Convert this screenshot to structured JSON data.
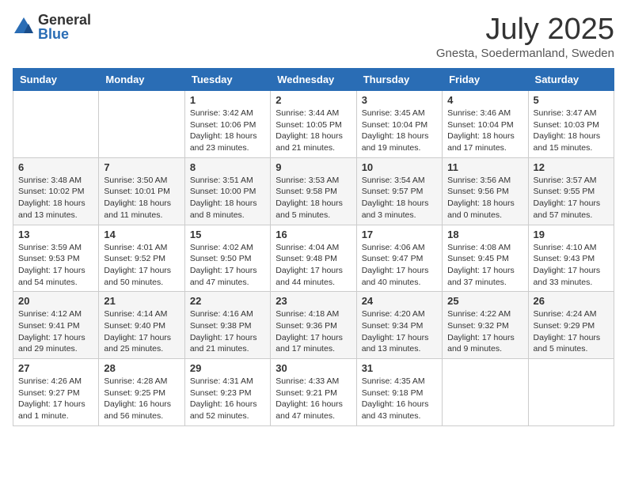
{
  "header": {
    "logo_general": "General",
    "logo_blue": "Blue",
    "month_title": "July 2025",
    "subtitle": "Gnesta, Soedermanland, Sweden"
  },
  "weekdays": [
    "Sunday",
    "Monday",
    "Tuesday",
    "Wednesday",
    "Thursday",
    "Friday",
    "Saturday"
  ],
  "weeks": [
    [
      {
        "day": "",
        "info": ""
      },
      {
        "day": "",
        "info": ""
      },
      {
        "day": "1",
        "info": "Sunrise: 3:42 AM\nSunset: 10:06 PM\nDaylight: 18 hours\nand 23 minutes."
      },
      {
        "day": "2",
        "info": "Sunrise: 3:44 AM\nSunset: 10:05 PM\nDaylight: 18 hours\nand 21 minutes."
      },
      {
        "day": "3",
        "info": "Sunrise: 3:45 AM\nSunset: 10:04 PM\nDaylight: 18 hours\nand 19 minutes."
      },
      {
        "day": "4",
        "info": "Sunrise: 3:46 AM\nSunset: 10:04 PM\nDaylight: 18 hours\nand 17 minutes."
      },
      {
        "day": "5",
        "info": "Sunrise: 3:47 AM\nSunset: 10:03 PM\nDaylight: 18 hours\nand 15 minutes."
      }
    ],
    [
      {
        "day": "6",
        "info": "Sunrise: 3:48 AM\nSunset: 10:02 PM\nDaylight: 18 hours\nand 13 minutes."
      },
      {
        "day": "7",
        "info": "Sunrise: 3:50 AM\nSunset: 10:01 PM\nDaylight: 18 hours\nand 11 minutes."
      },
      {
        "day": "8",
        "info": "Sunrise: 3:51 AM\nSunset: 10:00 PM\nDaylight: 18 hours\nand 8 minutes."
      },
      {
        "day": "9",
        "info": "Sunrise: 3:53 AM\nSunset: 9:58 PM\nDaylight: 18 hours\nand 5 minutes."
      },
      {
        "day": "10",
        "info": "Sunrise: 3:54 AM\nSunset: 9:57 PM\nDaylight: 18 hours\nand 3 minutes."
      },
      {
        "day": "11",
        "info": "Sunrise: 3:56 AM\nSunset: 9:56 PM\nDaylight: 18 hours\nand 0 minutes."
      },
      {
        "day": "12",
        "info": "Sunrise: 3:57 AM\nSunset: 9:55 PM\nDaylight: 17 hours\nand 57 minutes."
      }
    ],
    [
      {
        "day": "13",
        "info": "Sunrise: 3:59 AM\nSunset: 9:53 PM\nDaylight: 17 hours\nand 54 minutes."
      },
      {
        "day": "14",
        "info": "Sunrise: 4:01 AM\nSunset: 9:52 PM\nDaylight: 17 hours\nand 50 minutes."
      },
      {
        "day": "15",
        "info": "Sunrise: 4:02 AM\nSunset: 9:50 PM\nDaylight: 17 hours\nand 47 minutes."
      },
      {
        "day": "16",
        "info": "Sunrise: 4:04 AM\nSunset: 9:48 PM\nDaylight: 17 hours\nand 44 minutes."
      },
      {
        "day": "17",
        "info": "Sunrise: 4:06 AM\nSunset: 9:47 PM\nDaylight: 17 hours\nand 40 minutes."
      },
      {
        "day": "18",
        "info": "Sunrise: 4:08 AM\nSunset: 9:45 PM\nDaylight: 17 hours\nand 37 minutes."
      },
      {
        "day": "19",
        "info": "Sunrise: 4:10 AM\nSunset: 9:43 PM\nDaylight: 17 hours\nand 33 minutes."
      }
    ],
    [
      {
        "day": "20",
        "info": "Sunrise: 4:12 AM\nSunset: 9:41 PM\nDaylight: 17 hours\nand 29 minutes."
      },
      {
        "day": "21",
        "info": "Sunrise: 4:14 AM\nSunset: 9:40 PM\nDaylight: 17 hours\nand 25 minutes."
      },
      {
        "day": "22",
        "info": "Sunrise: 4:16 AM\nSunset: 9:38 PM\nDaylight: 17 hours\nand 21 minutes."
      },
      {
        "day": "23",
        "info": "Sunrise: 4:18 AM\nSunset: 9:36 PM\nDaylight: 17 hours\nand 17 minutes."
      },
      {
        "day": "24",
        "info": "Sunrise: 4:20 AM\nSunset: 9:34 PM\nDaylight: 17 hours\nand 13 minutes."
      },
      {
        "day": "25",
        "info": "Sunrise: 4:22 AM\nSunset: 9:32 PM\nDaylight: 17 hours\nand 9 minutes."
      },
      {
        "day": "26",
        "info": "Sunrise: 4:24 AM\nSunset: 9:29 PM\nDaylight: 17 hours\nand 5 minutes."
      }
    ],
    [
      {
        "day": "27",
        "info": "Sunrise: 4:26 AM\nSunset: 9:27 PM\nDaylight: 17 hours\nand 1 minute."
      },
      {
        "day": "28",
        "info": "Sunrise: 4:28 AM\nSunset: 9:25 PM\nDaylight: 16 hours\nand 56 minutes."
      },
      {
        "day": "29",
        "info": "Sunrise: 4:31 AM\nSunset: 9:23 PM\nDaylight: 16 hours\nand 52 minutes."
      },
      {
        "day": "30",
        "info": "Sunrise: 4:33 AM\nSunset: 9:21 PM\nDaylight: 16 hours\nand 47 minutes."
      },
      {
        "day": "31",
        "info": "Sunrise: 4:35 AM\nSunset: 9:18 PM\nDaylight: 16 hours\nand 43 minutes."
      },
      {
        "day": "",
        "info": ""
      },
      {
        "day": "",
        "info": ""
      }
    ]
  ]
}
